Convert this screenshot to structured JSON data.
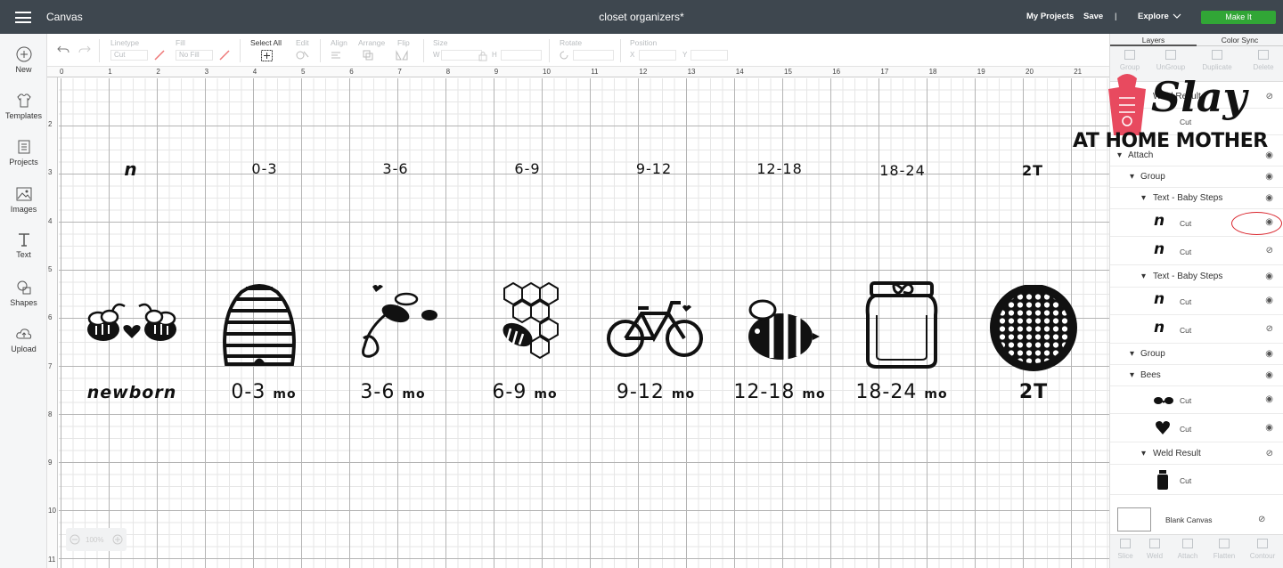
{
  "topbar": {
    "app_name": "Canvas",
    "doc_title": "closet organizers*",
    "my_projects": "My Projects",
    "save": "Save",
    "divider": "|",
    "explore": "Explore",
    "make_it": "Make It"
  },
  "leftnav": [
    {
      "label": "New",
      "icon": "plus-circle-icon"
    },
    {
      "label": "Templates",
      "icon": "tshirt-icon"
    },
    {
      "label": "Projects",
      "icon": "projects-icon"
    },
    {
      "label": "Images",
      "icon": "image-icon"
    },
    {
      "label": "Text",
      "icon": "text-icon"
    },
    {
      "label": "Shapes",
      "icon": "shapes-icon"
    },
    {
      "label": "Upload",
      "icon": "upload-cloud-icon"
    }
  ],
  "toolbar": {
    "linetype_label": "Linetype",
    "linetype_value": "Cut",
    "fill_label": "Fill",
    "fill_value": "No Fill",
    "select_all": "Select All",
    "edit": "Edit",
    "align": "Align",
    "arrange": "Arrange",
    "flip": "Flip",
    "size": "Size",
    "w": "W",
    "h": "H",
    "rotate": "Rotate",
    "position": "Position",
    "x": "X",
    "y": "Y"
  },
  "ruler": {
    "top": [
      "0",
      "1",
      "2",
      "3",
      "4",
      "5",
      "6",
      "7",
      "8",
      "9",
      "10",
      "11",
      "12",
      "13",
      "14",
      "15",
      "16",
      "17",
      "18",
      "19",
      "20",
      "21"
    ],
    "left": [
      "2",
      "3",
      "4",
      "5",
      "6",
      "7",
      "8",
      "9",
      "10",
      "11"
    ]
  },
  "canvas": {
    "symbols": [
      "n",
      "0-3",
      "3-6",
      "6-9",
      "9-12",
      "12-18",
      "18-24",
      "2T"
    ],
    "labels": [
      {
        "num": "newborn",
        "unit": ""
      },
      {
        "num": "0-3",
        "unit": "mo"
      },
      {
        "num": "3-6",
        "unit": "mo"
      },
      {
        "num": "6-9",
        "unit": "mo"
      },
      {
        "num": "9-12",
        "unit": "mo"
      },
      {
        "num": "12-18",
        "unit": "mo"
      },
      {
        "num": "18-24",
        "unit": "mo"
      },
      {
        "num": "2T",
        "unit": ""
      }
    ],
    "zoom": "100%"
  },
  "panel": {
    "tabs": [
      "Layers",
      "Color Sync"
    ],
    "tools": [
      "Group",
      "UnGroup",
      "Duplicate",
      "Delete"
    ],
    "rows": [
      {
        "text": "Weld Result",
        "eye": "hidden"
      },
      {
        "text": "Cut",
        "eye": ""
      },
      {
        "text": "Attach",
        "eye": "visible"
      },
      {
        "text": "Group",
        "eye": "visible"
      },
      {
        "text": "Text - Baby Steps",
        "eye": "visible"
      },
      {
        "text": "Cut",
        "thumb": "n",
        "eye": "visible"
      },
      {
        "text": "Cut",
        "thumb": "n",
        "eye": "hidden"
      },
      {
        "text": "Text - Baby Steps",
        "eye": "visible"
      },
      {
        "text": "Cut",
        "thumb": "n",
        "eye": "visible"
      },
      {
        "text": "Cut",
        "thumb": "n",
        "eye": "hidden"
      },
      {
        "text": "Group",
        "eye": "visible"
      },
      {
        "text": "Bees",
        "eye": "visible"
      },
      {
        "text": "Cut",
        "thumb": "bees",
        "eye": "visible"
      },
      {
        "text": "Cut",
        "thumb": "heart",
        "eye": "visible"
      },
      {
        "text": "Weld Result",
        "eye": "hidden"
      },
      {
        "text": "Cut",
        "thumb": "jar",
        "eye": ""
      }
    ],
    "blank_canvas": "Blank Canvas",
    "bottom_tools": [
      "Slice",
      "Weld",
      "Attach",
      "Flatten",
      "Contour"
    ]
  },
  "watermark": {
    "slay": "Slay",
    "text": "AT HOME MOTHER"
  },
  "colors": {
    "topbar": "#3e474f",
    "make_it": "#31a636",
    "highlight": "#d9232b"
  }
}
